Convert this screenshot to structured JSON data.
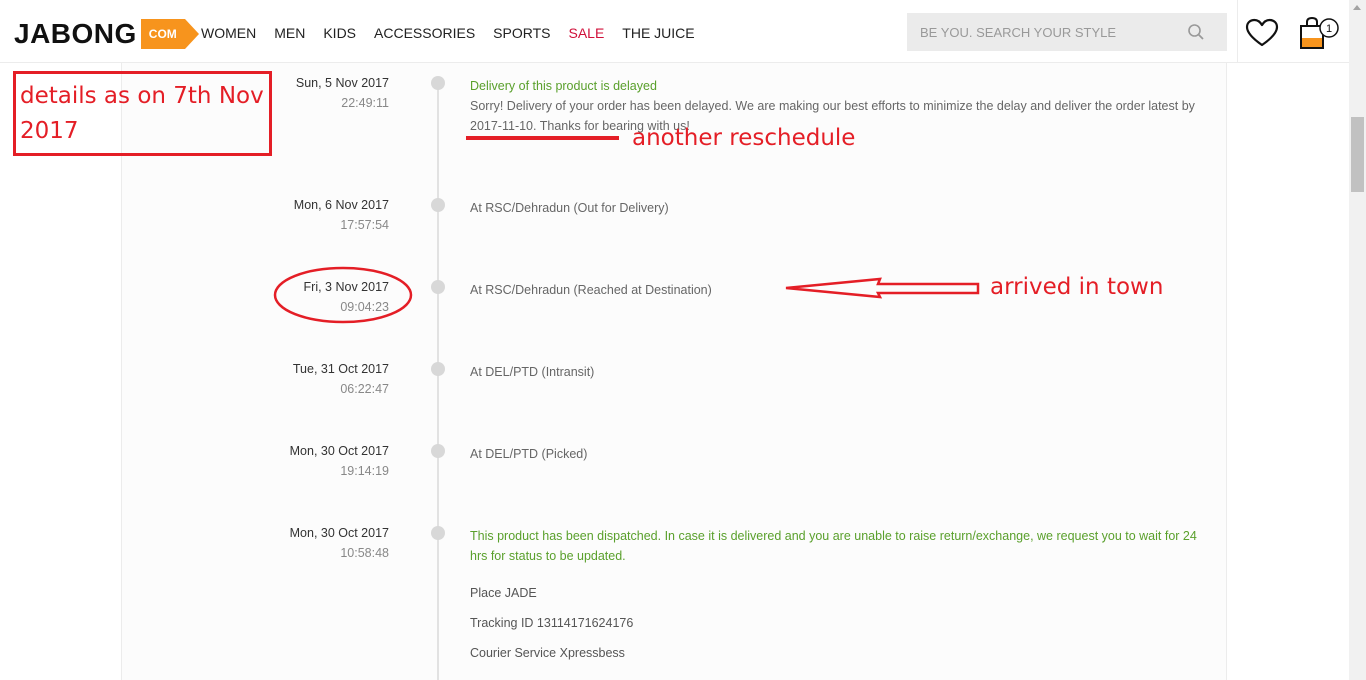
{
  "header": {
    "logo": {
      "text": "JABONG",
      "badge": "COM"
    },
    "nav": [
      "WOMEN",
      "MEN",
      "KIDS",
      "ACCESSORIES",
      "SPORTS",
      "SALE",
      "THE JUICE"
    ],
    "search_placeholder": "BE YOU. SEARCH YOUR STYLE",
    "cart_count": "1",
    "colors": {
      "brand": "#f7941d",
      "sale": "#d0103a"
    }
  },
  "timeline": [
    {
      "date": "Sun, 5 Nov 2017",
      "time": "22:49:11",
      "status": "Delivery of this product is delayed",
      "highlight": true,
      "description": "Sorry! Delivery of your order has been delayed. We are making our best efforts to minimize the delay and deliver the order latest by 2017-11-10. Thanks for bearing with us!"
    },
    {
      "date": "Mon, 6 Nov 2017",
      "time": "17:57:54",
      "status": "At RSC/Dehradun (Out for Delivery)",
      "highlight": false
    },
    {
      "date": "Fri, 3 Nov 2017",
      "time": "09:04:23",
      "status": "At RSC/Dehradun (Reached at Destination)",
      "highlight": false
    },
    {
      "date": "Tue, 31 Oct 2017",
      "time": "06:22:47",
      "status": "At DEL/PTD (Intransit)",
      "highlight": false
    },
    {
      "date": "Mon, 30 Oct 2017",
      "time": "19:14:19",
      "status": "At DEL/PTD (Picked)",
      "highlight": false
    },
    {
      "date": "Mon, 30 Oct 2017",
      "time": "10:58:48",
      "status": "This product has been dispatched. In case it is delivered and you are unable to raise return/exchange, we request you to wait for 24 hrs for status to be updated.",
      "highlight": true,
      "extra": [
        "Place JADE",
        "Tracking ID 13114171624176",
        "Courier Service Xpressbess"
      ]
    }
  ],
  "annotations": {
    "box_text": "details as on 7th Nov 2017",
    "reschedule": "another reschedule",
    "arrived": "arrived in town",
    "color": "#e41e26"
  }
}
